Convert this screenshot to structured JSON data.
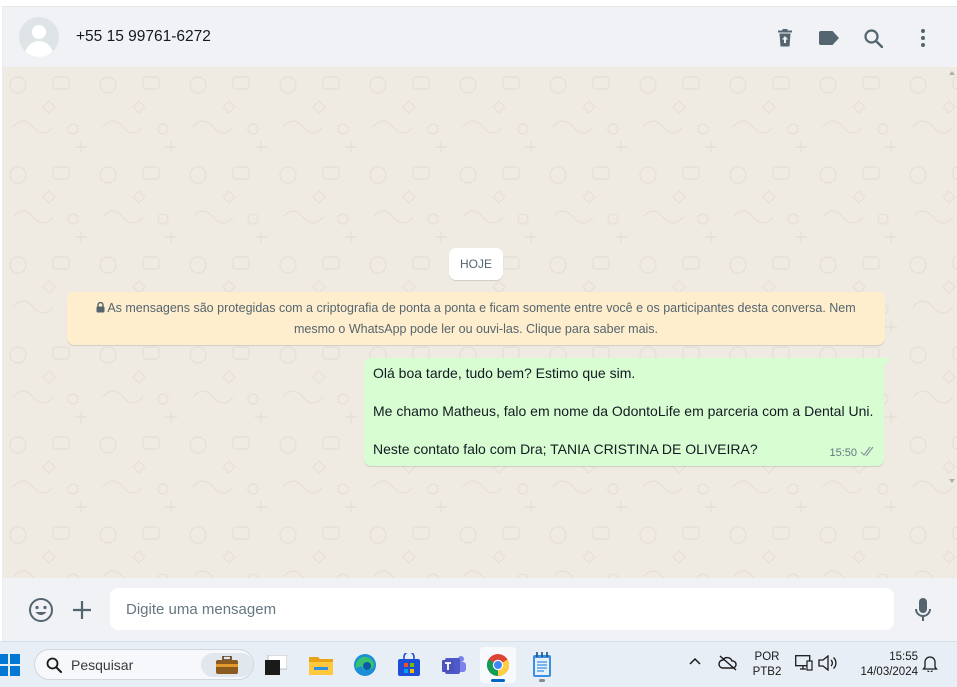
{
  "header": {
    "contact_name": "+55 15 99761-6272",
    "icons": [
      "delete-icon",
      "label-icon",
      "search-icon",
      "menu-icon"
    ]
  },
  "chat": {
    "date_divider": "HOJE",
    "encryption_notice": {
      "line1": "As mensagens são protegidas com a criptografia de ponta a ponta e ficam somente entre você e os participantes desta conversa. Nem",
      "line2": "mesmo o WhatsApp pode ler ou ouvi-las. Clique para saber mais."
    },
    "messages": [
      {
        "direction": "outgoing",
        "lines": [
          "Olá boa tarde, tudo bem? Estimo que sim.",
          "Me chamo Matheus, falo em nome da OdontoLife em parceria com a Dental Uni.",
          "Neste contato falo com Dra; TANIA CRISTINA DE OLIVEIRA?"
        ],
        "time": "15:50",
        "status": "delivered"
      }
    ],
    "background_color": "#efeae2",
    "outgoing_bubble_color": "#d9fdd3",
    "notice_color": "#ffeecd"
  },
  "composer": {
    "placeholder": "Digite uma mensagem"
  },
  "taskbar": {
    "search_label": "Pesquisar",
    "apps": [
      "work-briefcase",
      "app-window",
      "file-explorer",
      "edge",
      "microsoft-store",
      "teams",
      "chrome",
      "notepad"
    ],
    "active_app": "chrome",
    "language": "POR",
    "keyboard": "PTB2",
    "time": "15:55",
    "date": "14/03/2024"
  }
}
